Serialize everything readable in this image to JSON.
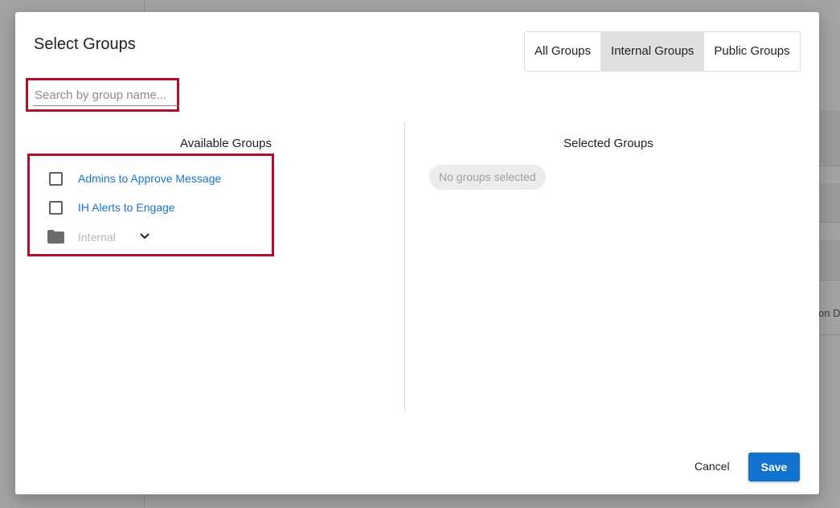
{
  "background": {
    "clipped_text": "on D"
  },
  "modal": {
    "title": "Select Groups",
    "filters": [
      {
        "label": "All Groups",
        "active": false
      },
      {
        "label": "Internal Groups",
        "active": true
      },
      {
        "label": "Public Groups",
        "active": false
      }
    ],
    "search": {
      "placeholder": "Search by group name...",
      "value": ""
    },
    "available": {
      "header": "Available Groups",
      "items": [
        {
          "label": "Admins to Approve Message",
          "checked": false
        },
        {
          "label": "IH Alerts to Engage",
          "checked": false
        }
      ],
      "folder": {
        "label": "Internal",
        "icon": "folder-icon",
        "expand_icon": "chevron-down-icon"
      }
    },
    "selected": {
      "header": "Selected Groups",
      "empty_text": "No groups selected"
    },
    "footer": {
      "cancel_label": "Cancel",
      "save_label": "Save"
    }
  },
  "colors": {
    "accent": "#1272cf",
    "link": "#1a73c9",
    "highlight_border": "#b0102a",
    "active_toggle": "#e0e0e0"
  }
}
